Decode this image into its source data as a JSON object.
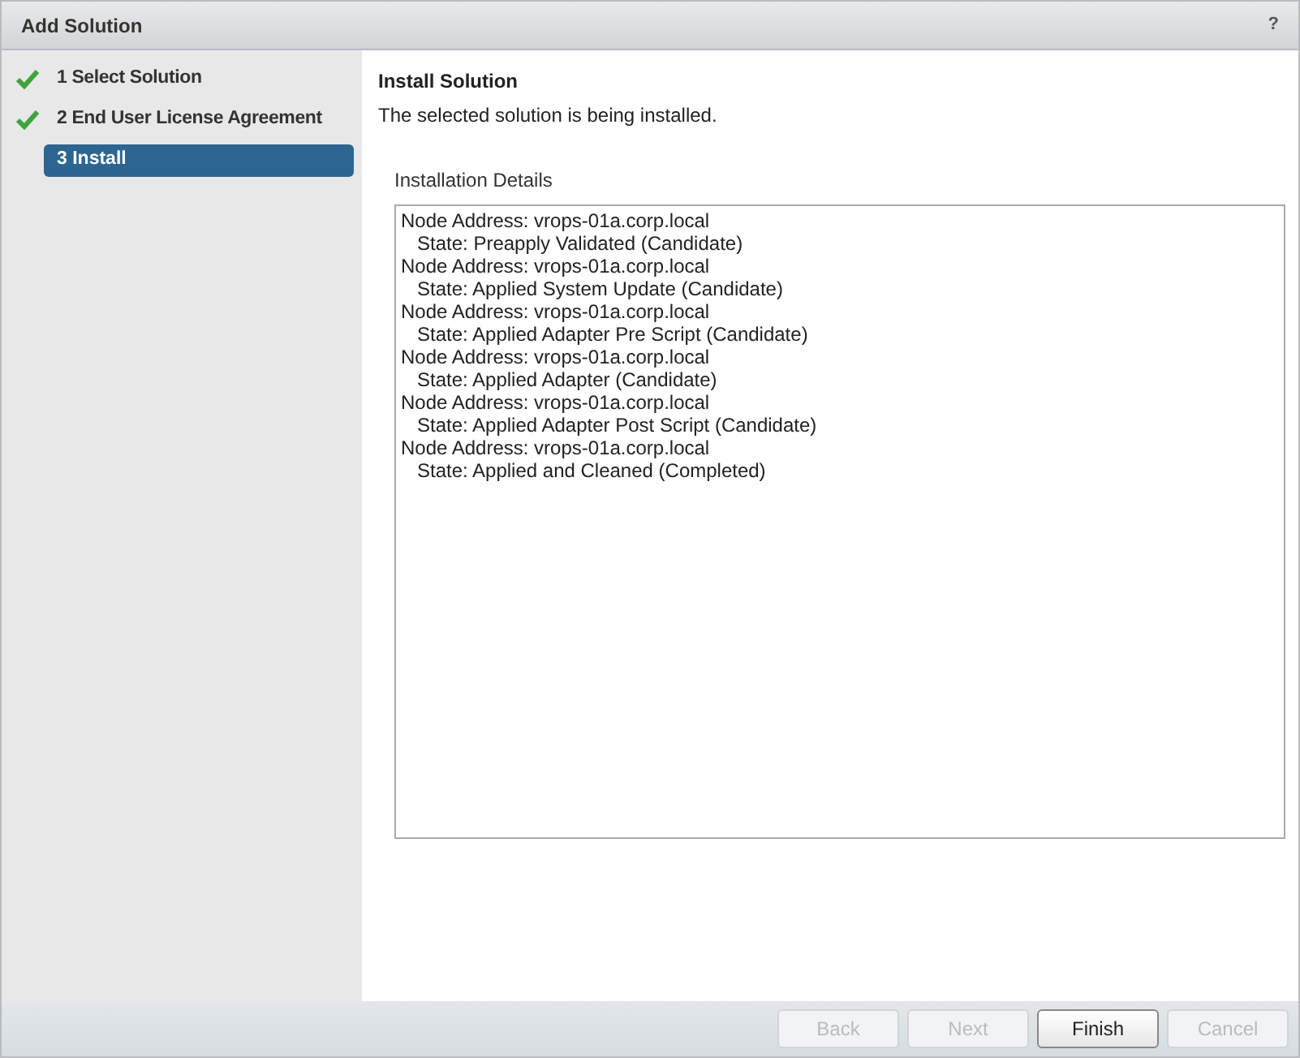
{
  "window": {
    "title": "Add Solution",
    "help": "?"
  },
  "steps": [
    {
      "number": "1",
      "label": "Select Solution",
      "completed": true,
      "selected": false
    },
    {
      "number": "2",
      "label": "End User License Agreement",
      "completed": true,
      "selected": false
    },
    {
      "number": "3",
      "label": "Install",
      "completed": false,
      "selected": true
    }
  ],
  "content": {
    "heading": "Install Solution",
    "description": "The selected solution is being installed.",
    "details_label": "Installation Details",
    "details": [
      {
        "node": "Node Address: vrops-01a.corp.local",
        "state": "State: Preapply Validated (Candidate)"
      },
      {
        "node": "Node Address: vrops-01a.corp.local",
        "state": "State: Applied System Update (Candidate)"
      },
      {
        "node": "Node Address: vrops-01a.corp.local",
        "state": "State: Applied Adapter Pre Script (Candidate)"
      },
      {
        "node": "Node Address: vrops-01a.corp.local",
        "state": "State: Applied Adapter (Candidate)"
      },
      {
        "node": "Node Address: vrops-01a.corp.local",
        "state": "State: Applied Adapter Post Script (Candidate)"
      },
      {
        "node": "Node Address: vrops-01a.corp.local",
        "state": "State: Applied and Cleaned (Completed)"
      }
    ]
  },
  "buttons": [
    {
      "label": "Back",
      "disabled": true
    },
    {
      "label": "Next",
      "disabled": true
    },
    {
      "label": "Finish",
      "disabled": false
    },
    {
      "label": "Cancel",
      "disabled": true
    }
  ]
}
